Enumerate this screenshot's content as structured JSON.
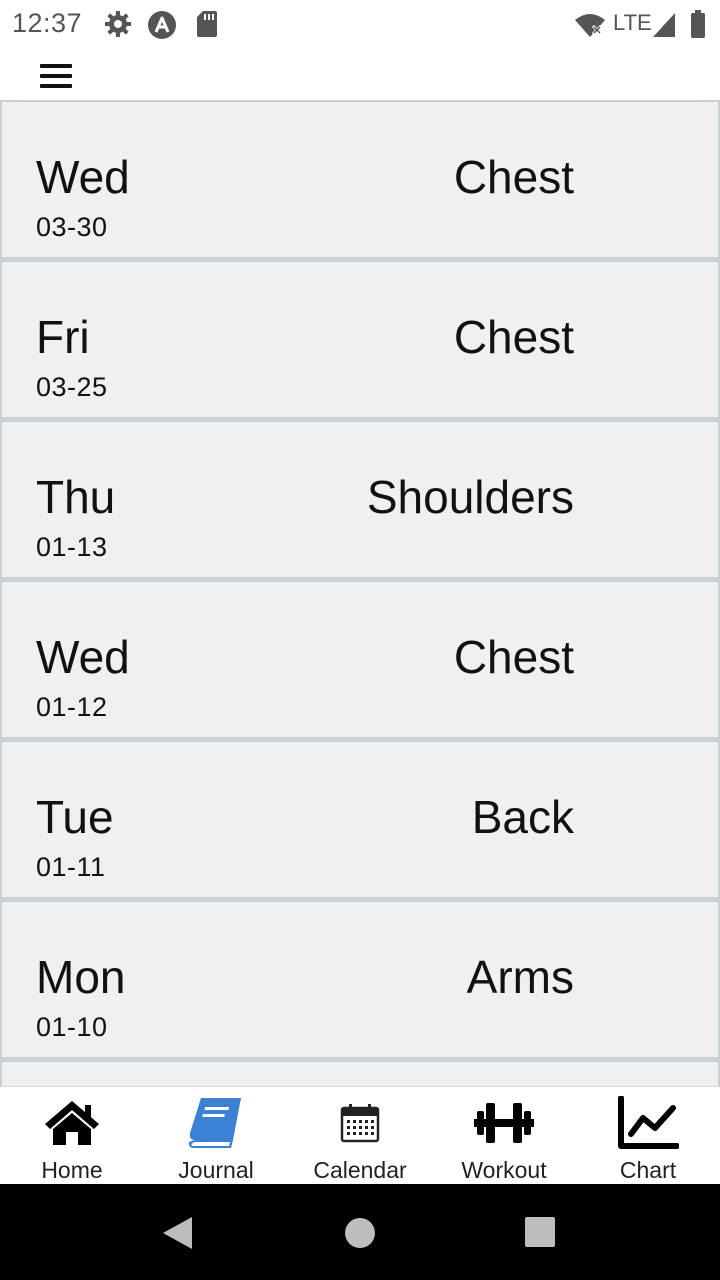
{
  "status_bar": {
    "time": "12:37",
    "network": "LTE",
    "icons": [
      "settings-icon",
      "a-badge-icon",
      "sd-card-icon",
      "wifi-x-icon",
      "signal-icon",
      "battery-icon"
    ]
  },
  "header": {
    "menu_icon": "hamburger-menu-icon"
  },
  "entries": [
    {
      "day": "Wed",
      "date": "03-30",
      "muscle": "Chest"
    },
    {
      "day": "Fri",
      "date": "03-25",
      "muscle": "Chest"
    },
    {
      "day": "Thu",
      "date": "01-13",
      "muscle": "Shoulders"
    },
    {
      "day": "Wed",
      "date": "01-12",
      "muscle": "Chest"
    },
    {
      "day": "Tue",
      "date": "01-11",
      "muscle": "Back"
    },
    {
      "day": "Mon",
      "date": "01-10",
      "muscle": "Arms"
    }
  ],
  "nav": {
    "active_color": "#3b82d6",
    "items": [
      {
        "label": "Home",
        "icon": "home-icon"
      },
      {
        "label": "Journal",
        "icon": "book-icon",
        "active": true
      },
      {
        "label": "Calendar",
        "icon": "calendar-icon"
      },
      {
        "label": "Workout",
        "icon": "dumbbell-icon"
      },
      {
        "label": "Chart",
        "icon": "line-chart-icon"
      }
    ]
  }
}
